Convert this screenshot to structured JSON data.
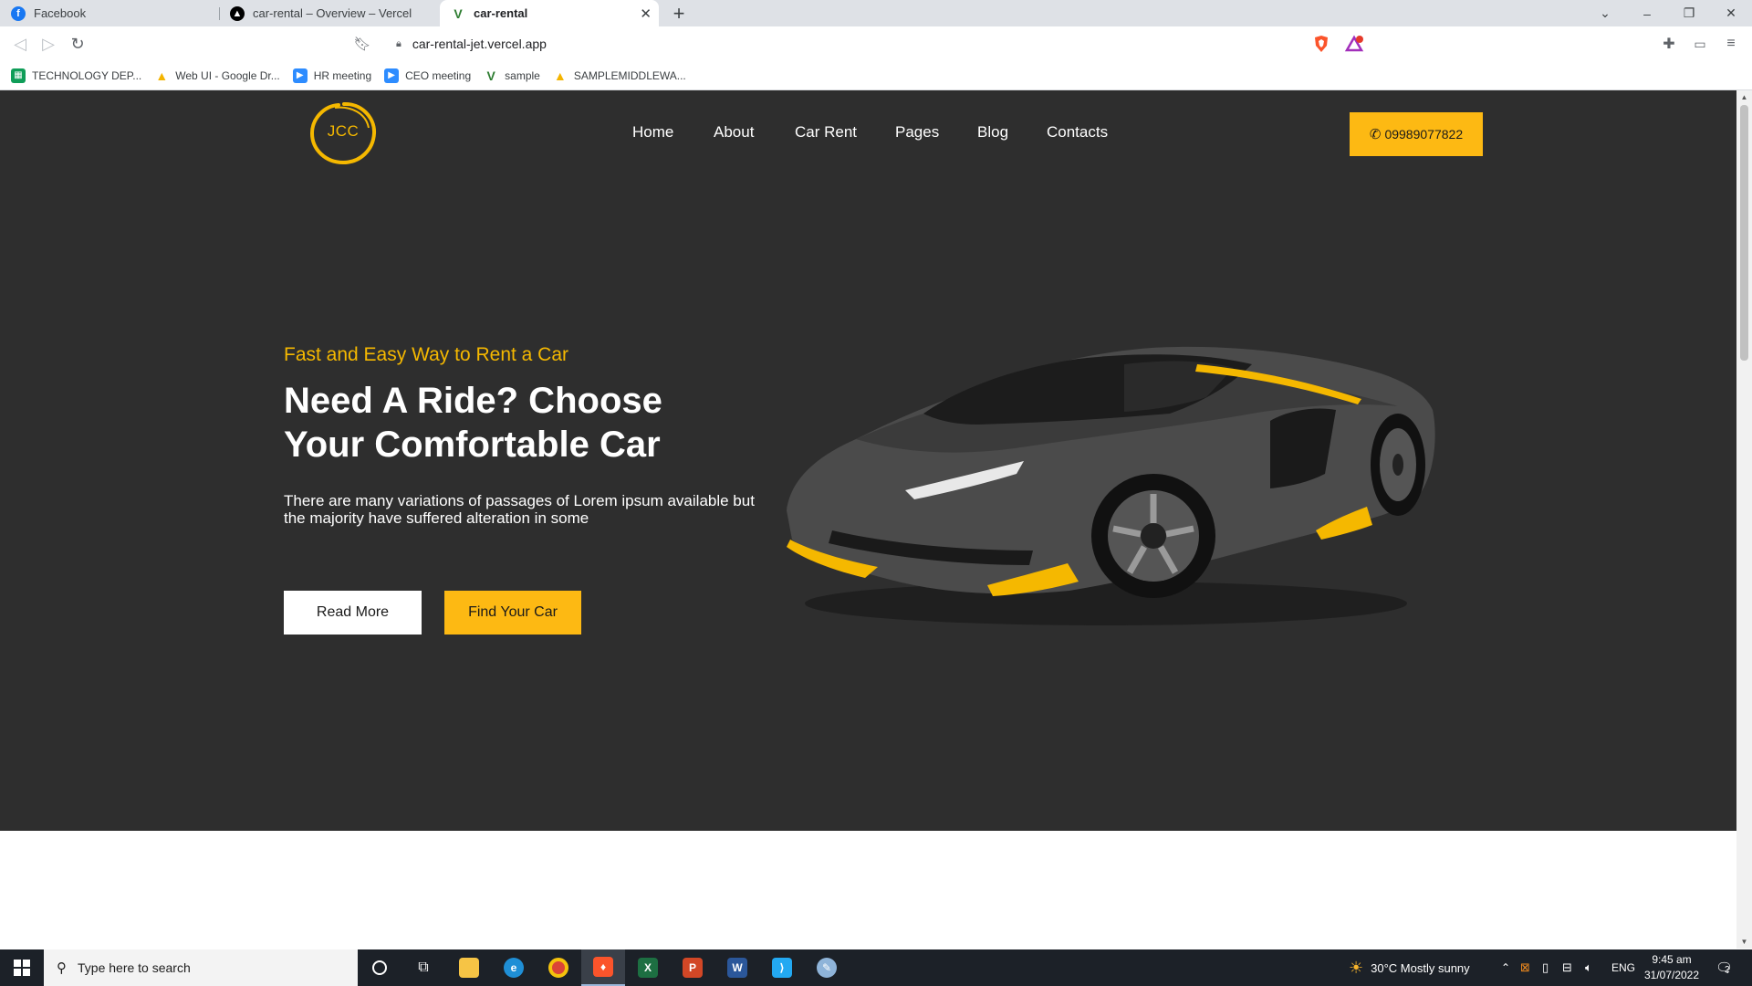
{
  "browser": {
    "tabs": [
      {
        "title": "Facebook",
        "favicon": "facebook-icon"
      },
      {
        "title": "car-rental – Overview – Vercel",
        "favicon": "vercel-icon"
      },
      {
        "title": "car-rental",
        "favicon": "vercel-v-icon",
        "active": true
      }
    ],
    "new_tab": "+",
    "window_controls": {
      "dropdown": "⌄",
      "minimize": "–",
      "restore": "❐",
      "close": "✕"
    },
    "url": "car-rental-jet.vercel.app",
    "bookmarks": [
      {
        "label": "TECHNOLOGY DEP...",
        "icon": "sheets-icon",
        "color": "#0f9d58"
      },
      {
        "label": "Web UI - Google Dr...",
        "icon": "drive-icon",
        "color": "#f4b400"
      },
      {
        "label": "HR meeting",
        "icon": "zoom-icon",
        "color": "#2d8cff"
      },
      {
        "label": "CEO meeting",
        "icon": "zoom-icon",
        "color": "#2d8cff"
      },
      {
        "label": "sample",
        "icon": "vercel-v-icon",
        "color": "#2e7d32"
      },
      {
        "label": "SAMPLEMIDDLEWA...",
        "icon": "drive-icon",
        "color": "#f4b400"
      }
    ]
  },
  "site": {
    "logo": "JCC",
    "nav": [
      "Home",
      "About",
      "Car Rent",
      "Pages",
      "Blog",
      "Contacts"
    ],
    "phone": "09989077822",
    "hero": {
      "tagline": "Fast and Easy Way to Rent a Car",
      "headline_line1": "Need A Ride? Choose",
      "headline_line2": "Your Comfortable Car",
      "description": "There are many variations of passages of Lorem ipsum available but the majority have suffered alteration in some",
      "read_more": "Read More",
      "find_car": "Find Your Car"
    },
    "accent_color": "#fdb913",
    "hero_bg": "#2e2e2e"
  },
  "taskbar": {
    "search_placeholder": "Type here to search",
    "weather": "30°C  Mostly sunny",
    "language": "ENG",
    "time": "9:45 am",
    "date": "31/07/2022",
    "notifications": "2"
  }
}
